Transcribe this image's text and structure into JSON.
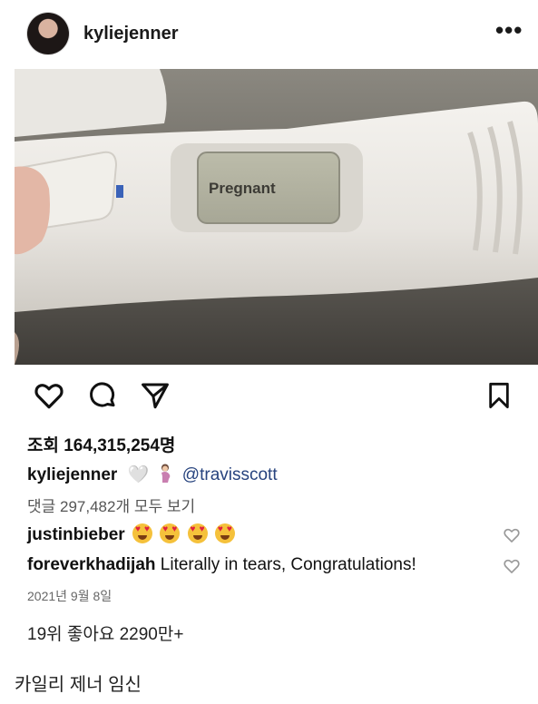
{
  "post": {
    "username": "kyliejenner",
    "more_label": "•••",
    "views_label": "조회 164,315,254명",
    "caption_user": "kyliejenner",
    "caption_heart": "🤍",
    "caption_mention": "@travisscott",
    "view_comments": "댓글 297,482개 모두 보기",
    "comments": [
      {
        "user": "justinbieber",
        "text": ""
      },
      {
        "user": "foreverkhadijah",
        "text": "Literally in tears, Congratulations!"
      }
    ],
    "date": "2021년 9월 8일",
    "pregnancy_display": "Pregnant"
  },
  "footer": {
    "stats": "19위 좋아요 2290만+",
    "headline": "카일리 제너 임신"
  },
  "icons": {
    "like": "heart-icon",
    "comment": "comment-icon",
    "share": "send-icon",
    "save": "bookmark-icon",
    "mute": "speaker-muted-icon",
    "comment_like": "heart-small-icon"
  },
  "colors": {
    "mention": "#27437e",
    "emoji_face": "#f5c13b",
    "emoji_heart": "#e0213f"
  }
}
